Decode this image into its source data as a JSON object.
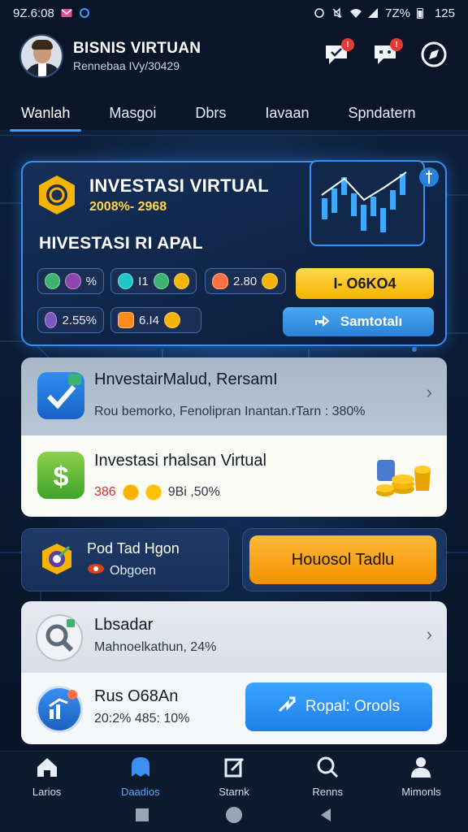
{
  "status_bar": {
    "time": "9Z.6:08",
    "battery_text": "7Z%",
    "battery_level": "125"
  },
  "header": {
    "app_title": "BISNIS VIRTUAN",
    "app_subtitle": "Rennebaa IVy/30429",
    "badge_1": "!",
    "badge_2": "!"
  },
  "tabs": [
    {
      "label": "Wanlah",
      "active": true
    },
    {
      "label": "Masgoi"
    },
    {
      "label": "Dbrs"
    },
    {
      "label": "Iavaan"
    },
    {
      "label": "Spndatern"
    }
  ],
  "hero": {
    "title": "INVESTASI VIRTUAL",
    "stat": "2008%- 2968",
    "subtitle": "HIVESTASI RI APAL",
    "chips": [
      {
        "label": "%"
      },
      {
        "label": "I1"
      },
      {
        "label": "2.80"
      },
      {
        "label": "2.55%"
      },
      {
        "label": "6.I4"
      }
    ],
    "primary_button": "I- O6KO4",
    "secondary_button": "Samtotalı"
  },
  "list_items": [
    {
      "title": "HnvestairMalud, RersamI",
      "line": "Rou bemorko, Fenolipran Inantan.rTarn : 380%"
    },
    {
      "title": "Investasi rhalsan Virtual",
      "line_a": "386",
      "line_b": "9Bi ,50%"
    }
  ],
  "promo": {
    "title": "Pod Tad Hgon",
    "subtitle": "Obgoen"
  },
  "orange_button": "Houosol Tadlu",
  "list_items_2": [
    {
      "title": "Lbsadar",
      "line": "Mahnoelkathun, 24%"
    },
    {
      "title": "Rus O68An",
      "line": "20:2% 485: 10%"
    }
  ],
  "cta_button": "Ropal: Orools",
  "bottom_nav": [
    {
      "label": "Larios",
      "icon": "home-icon"
    },
    {
      "label": "Daadios",
      "icon": "ghost-icon",
      "active": true
    },
    {
      "label": "Starnk",
      "icon": "edit-icon"
    },
    {
      "label": "Renns",
      "icon": "search-icon"
    },
    {
      "label": "Mimonls",
      "icon": "profile-icon"
    }
  ],
  "colors": {
    "accent": "#3aa0ff",
    "yellow": "#f4b400",
    "orange": "#f39200"
  }
}
